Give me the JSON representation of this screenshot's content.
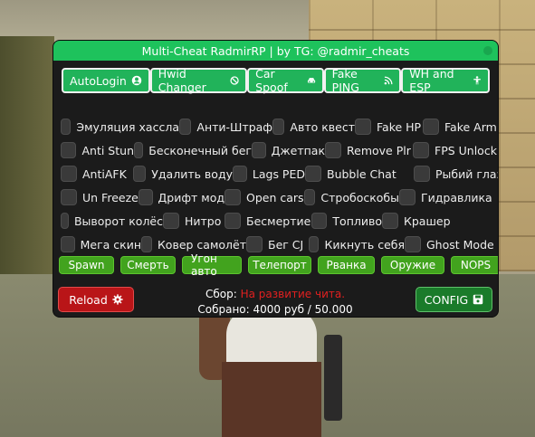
{
  "window": {
    "title": "Multi-Cheat RadmirRP | by TG: @radmir_cheats"
  },
  "tabs": [
    {
      "label": "AutoLogin",
      "icon": "user-circle-icon"
    },
    {
      "label": "Hwid Changer",
      "icon": "ban-icon"
    },
    {
      "label": "Car Spoof",
      "icon": "car-icon"
    },
    {
      "label": "Fake PING",
      "icon": "rss-icon"
    },
    {
      "label": "WH and ESP",
      "icon": "person-icon"
    }
  ],
  "options": {
    "row1": [
      "Эмуляция хассла",
      "Анти-Штраф",
      "Авто квест",
      "Fake HP",
      "Fake Arm"
    ],
    "row2": [
      "Anti Stun",
      "Бесконечный бег",
      "Джетпак",
      "Remove Plr",
      "FPS Unlock"
    ],
    "row3": [
      "AntiAFK",
      "Удалить воду",
      "Lags PED",
      "Bubble Chat",
      "Рыбий глаз"
    ],
    "row4": [
      "Un Freeze",
      "Дрифт мод",
      "Open cars",
      "Стробоскобы",
      "Гидравлика"
    ],
    "row5": [
      "Выворот колёс",
      "Нитро",
      "Бесмертие",
      "Топливо",
      "Крашер"
    ],
    "row6": [
      "Мега скин",
      "Ковер самолёт",
      "Бег CJ",
      "Кикнуть себя",
      "Ghost Mode"
    ]
  },
  "actions": [
    "Spawn",
    "Смерть",
    "Угон авто",
    "Телепорт",
    "Рванка",
    "Оружие",
    "NOPS"
  ],
  "footer": {
    "reload_label": "Reload",
    "config_label": "CONFIG",
    "collect_prefix": "Сбор:",
    "collect_goal": "На развитие чита.",
    "collected": "Собрано: 4000 руб / 50.000 руб"
  },
  "colors": {
    "accent_green": "#1ec25c",
    "button_green": "#42a31e",
    "reload_red": "#b91518",
    "config_green": "#1a7b2a",
    "panel_bg": "#1b1b1b",
    "goal_red": "#e02020"
  }
}
